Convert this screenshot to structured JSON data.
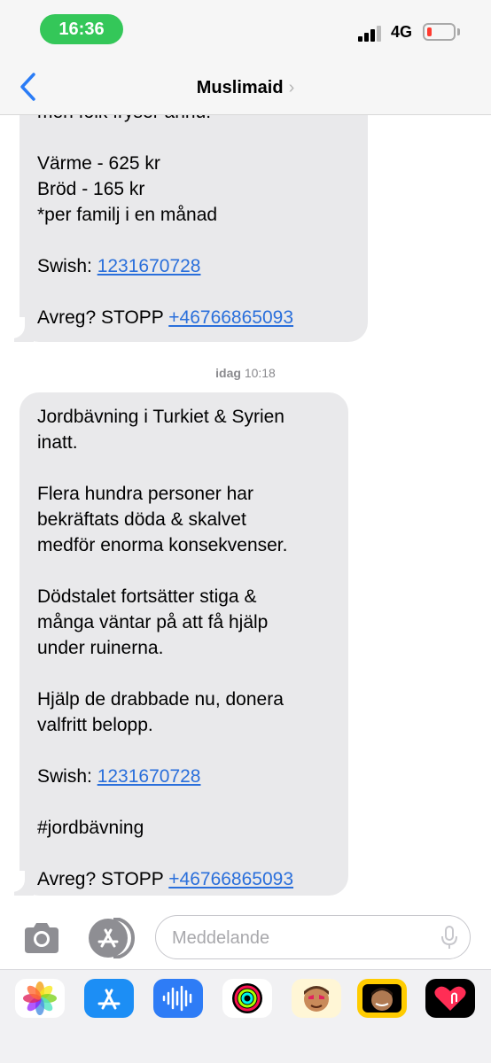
{
  "status_bar": {
    "time": "16:36",
    "network": "4G"
  },
  "nav": {
    "contact_name": "Muslimaid",
    "chevron": "›"
  },
  "messages": [
    {
      "lines": [
        {
          "text": "men folk fryser ännu!"
        },
        {
          "text": ""
        },
        {
          "text": "Värme - 625 kr"
        },
        {
          "text": "Bröd - 165 kr"
        },
        {
          "text": "*per familj i en månad"
        },
        {
          "text": ""
        },
        {
          "prefix": "Swish: ",
          "link": "1231670728"
        },
        {
          "text": ""
        },
        {
          "prefix": "Avreg? STOPP ",
          "link": "+46766865093"
        }
      ]
    },
    {
      "lines": [
        {
          "text": "Jordbävning i Turkiet & Syrien"
        },
        {
          "text": "inatt."
        },
        {
          "text": ""
        },
        {
          "text": "Flera hundra personer har"
        },
        {
          "text": "bekräftats döda & skalvet"
        },
        {
          "text": "medför enorma konsekvenser."
        },
        {
          "text": ""
        },
        {
          "text": "Dödstalet fortsätter stiga &"
        },
        {
          "text": "många väntar på att få hjälp"
        },
        {
          "text": "under ruinerna."
        },
        {
          "text": ""
        },
        {
          "text": "Hjälp de drabbade nu, donera"
        },
        {
          "text": "valfritt belopp."
        },
        {
          "text": ""
        },
        {
          "prefix": "Swish: ",
          "link": "1231670728"
        },
        {
          "text": ""
        },
        {
          "text": "#jordbävning"
        },
        {
          "text": ""
        },
        {
          "prefix": "Avreg? STOPP ",
          "link": "+46766865093"
        }
      ]
    }
  ],
  "timestamp": {
    "day": "idag",
    "time": "10:18"
  },
  "composer": {
    "placeholder": "Meddelande"
  },
  "icons": {
    "back": "chevron-left-icon",
    "camera": "camera-icon",
    "appstore": "app-store-icon",
    "mic": "microphone-icon"
  },
  "app_drawer": [
    {
      "name": "photos-app-icon"
    },
    {
      "name": "app-store-app-icon"
    },
    {
      "name": "audio-message-app-icon"
    },
    {
      "name": "activity-app-icon"
    },
    {
      "name": "memoji-stickers-app-icon"
    },
    {
      "name": "animoji-app-icon"
    },
    {
      "name": "digital-touch-app-icon"
    }
  ],
  "colors": {
    "status_pill": "#34c759",
    "accent_blue": "#2a7cf6",
    "link_blue": "#2a6fdb",
    "bubble_gray": "#e9e9eb",
    "battery_red": "#ff3b30"
  }
}
